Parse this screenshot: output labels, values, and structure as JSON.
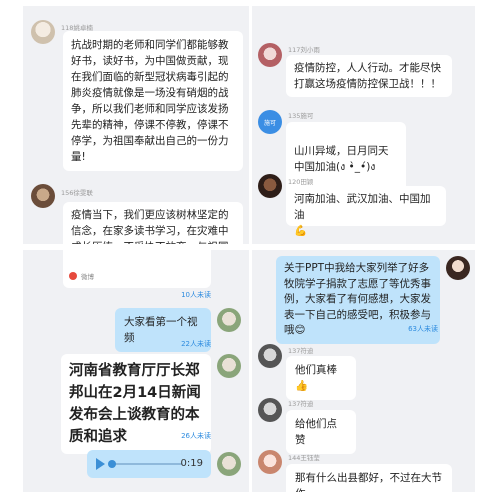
{
  "top_left": {
    "msg1": {
      "user": "118姚卓楠",
      "text": "抗战时期的老师和同学们都能够教好书，读好书，为中国做贡献，现在我们面临的新型冠状病毒引起的肺炎疫情就像是一场没有硝烟的战争，所以我们老师和同学应该发扬先辈的精神，停课不停教，停课不停学，为祖国奉献出自己的一份力量!"
    },
    "msg2": {
      "user": "156徐雯联",
      "text": "疫情当下，我们更应该树林坚定的信念，在家多读书学习，在灾难中成长历练，不妥协不放弃，与祖国一起成长"
    }
  },
  "top_right": {
    "msg1": {
      "user": "117刘小雨",
      "text": "疫情防控，人人行动。才能尽快打赢这场疫情防控保卫战！！！"
    },
    "msg2": {
      "user": "135施可",
      "avatar_text": "施可",
      "text": "山川异域，日月同天\n中国加油(ง •̀_•́)ง"
    },
    "msg3": {
      "user": "120田颖",
      "text": "河南加油、武汉加油、中国加油",
      "emoji": "💪"
    }
  },
  "bottom_left": {
    "card_sub": "微博",
    "read1": "10人未读",
    "msg1": {
      "text": "大家看第一个视频"
    },
    "read2": "22人未读",
    "news": {
      "text": "河南省教育厅厅长郑邦山在2月14日新闻发布会上谈教育的本质和追求"
    },
    "read3": "26人未读",
    "voice": {
      "duration": "0:19"
    }
  },
  "bottom_right": {
    "msg1": {
      "text": "关于PPT中我给大家列举了好多牧院学子捐款了志愿了等优秀事例，大家看了有何感想，大家发表一下自己的感受吧，积极参与哦",
      "emoji": "😊"
    },
    "read1": "63人未读",
    "msg2": {
      "user": "137符迪",
      "text": "他们真棒",
      "emoji": "👍"
    },
    "msg3": {
      "user": "137符迪",
      "text": "给他们点赞"
    },
    "msg4": {
      "user": "144王钰莹",
      "text": "那有什么出县都好，不过在大节作"
    }
  }
}
